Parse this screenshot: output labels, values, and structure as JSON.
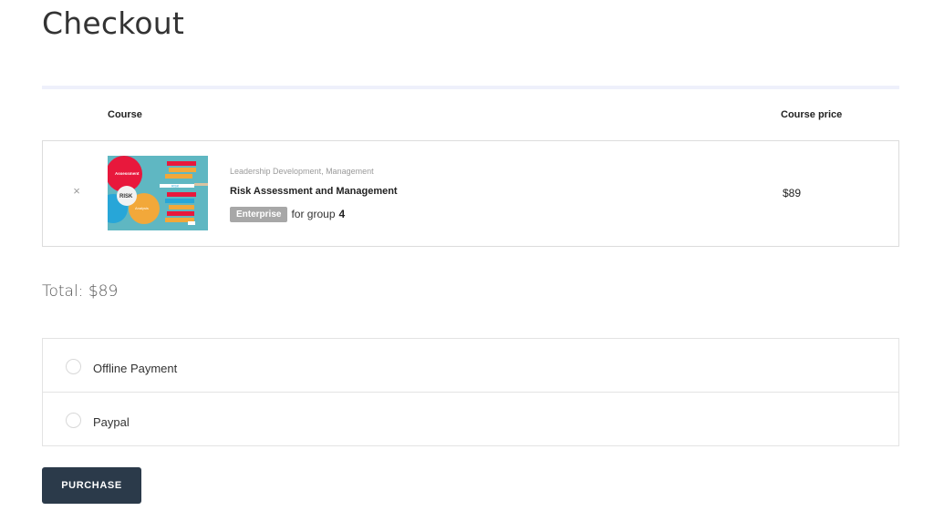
{
  "page": {
    "title": "Checkout"
  },
  "table": {
    "headers": {
      "course": "Course",
      "price": "Course price"
    }
  },
  "cart": {
    "items": [
      {
        "remove_icon": "×",
        "categories": "Leadership Development, Management",
        "name": "Risk Assessment and Management",
        "badge": "Enterprise",
        "group_text": "for group",
        "group_count": "4",
        "price": "$89",
        "thumbnail": {
          "icon": "risk-assessment-thumbnail",
          "labels": {
            "assessment": "Assessment",
            "risk": "RISK",
            "analysis": "Analysis",
            "list": "RISK"
          }
        }
      }
    ]
  },
  "total": {
    "text": "Total: $89"
  },
  "payment": {
    "options": [
      {
        "label": "Offline Payment",
        "selected": false
      },
      {
        "label": "Paypal",
        "selected": false
      }
    ]
  },
  "actions": {
    "purchase_label": "PURCHASE"
  },
  "colors": {
    "button_bg": "#2b3a4a",
    "badge_bg": "#a7a7a7",
    "thumbnail_bg": "#5fb7c2",
    "accent_red": "#e8183c",
    "accent_orange": "#f2a83a"
  }
}
